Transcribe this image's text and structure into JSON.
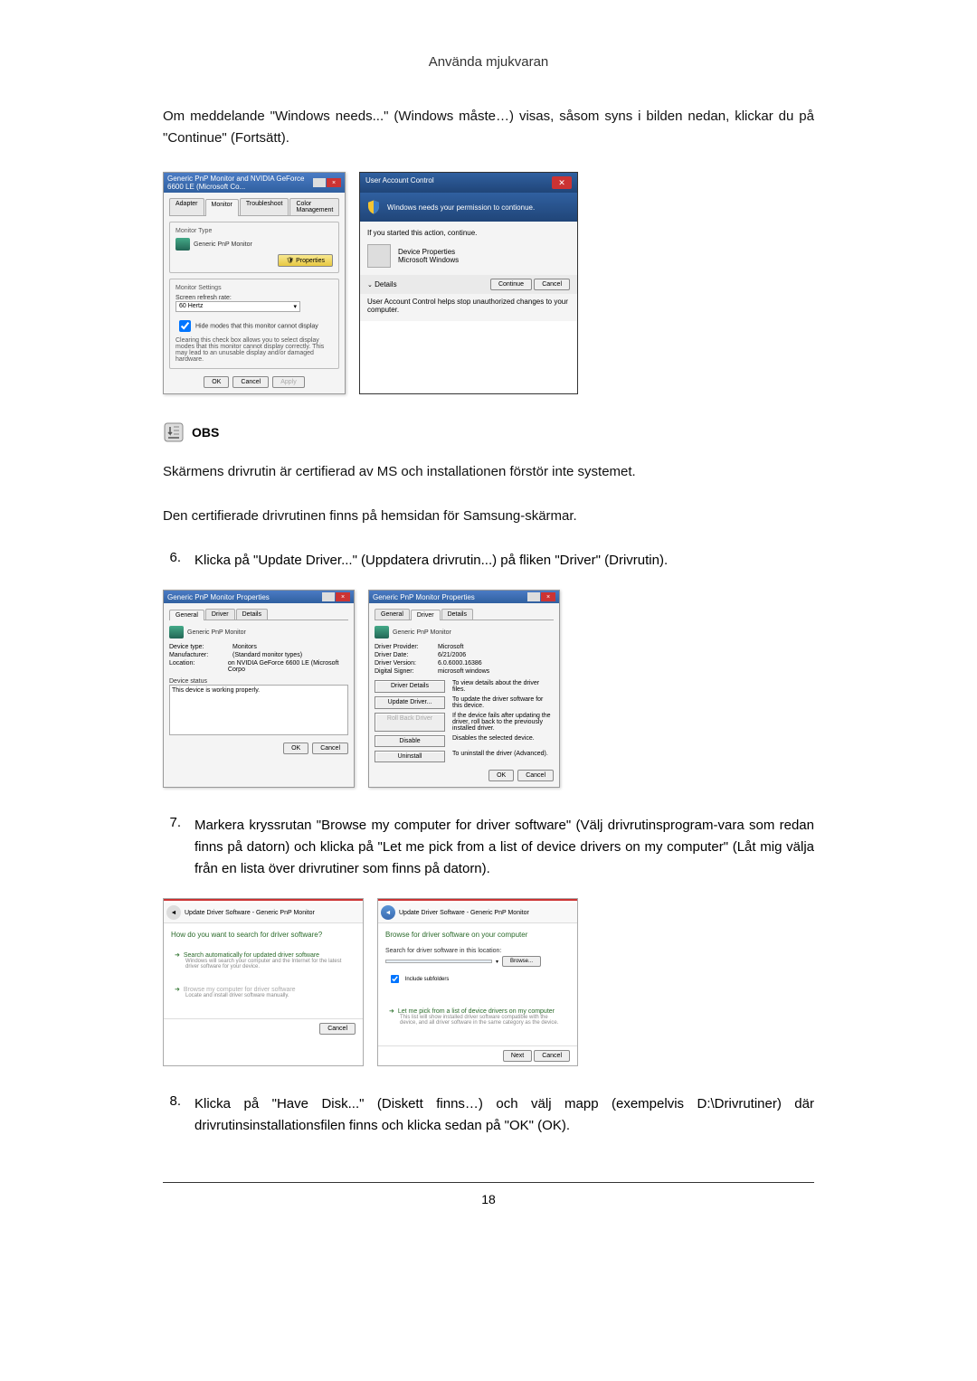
{
  "page": {
    "header_title": "Använda mjukvaran",
    "intro_text": "Om meddelande \"Windows needs...\" (Windows måste…) visas, såsom syns i bilden nedan, klickar du på \"Continue\" (Fortsätt).",
    "page_number": "18"
  },
  "dialog1": {
    "title": "Generic PnP Monitor and NVIDIA GeForce 6600 LE (Microsoft Co...",
    "tabs": {
      "adapter": "Adapter",
      "monitor": "Monitor",
      "troubleshoot": "Troubleshoot",
      "color": "Color Management"
    },
    "monitor_type_label": "Monitor Type",
    "monitor_name": "Generic PnP Monitor",
    "properties_btn": "Properties",
    "settings_label": "Monitor Settings",
    "refresh_label": "Screen refresh rate:",
    "refresh_value": "60 Hertz",
    "checkbox_label": "Hide modes that this monitor cannot display",
    "warning_text": "Clearing this check box allows you to select display modes that this monitor cannot display correctly. This may lead to an unusable display and/or damaged hardware.",
    "ok": "OK",
    "cancel": "Cancel",
    "apply": "Apply"
  },
  "uac": {
    "title": "User Account Control",
    "heading": "Windows needs your permission to contionue.",
    "subtext": "If you started this action, continue.",
    "device_props": "Device Properties",
    "ms_windows": "Microsoft Windows",
    "details": "Details",
    "continue_btn": "Continue",
    "cancel_btn": "Cancel",
    "footer": "User Account Control helps stop unauthorized changes to your computer."
  },
  "note": {
    "label": "OBS",
    "text1": "Skärmens drivrutin är certifierad av MS och installationen förstör inte systemet.",
    "text2": "Den certifierade drivrutinen finns på hemsidan för Samsung-skärmar."
  },
  "step6": {
    "num": "6.",
    "text": "Klicka på \"Update Driver...\" (Uppdatera drivrutin...) på fliken \"Driver\" (Drivrutin)."
  },
  "props_general": {
    "title": "Generic PnP Monitor Properties",
    "tabs": {
      "general": "General",
      "driver": "Driver",
      "details": "Details"
    },
    "name": "Generic PnP Monitor",
    "device_type_lbl": "Device type:",
    "device_type_val": "Monitors",
    "manufacturer_lbl": "Manufacturer:",
    "manufacturer_val": "(Standard monitor types)",
    "location_lbl": "Location:",
    "location_val": "on NVIDIA GeForce 6600 LE (Microsoft Corpo",
    "status_label": "Device status",
    "status_text": "This device is working properly.",
    "ok": "OK",
    "cancel": "Cancel"
  },
  "props_driver": {
    "title": "Generic PnP Monitor Properties",
    "name": "Generic PnP Monitor",
    "provider_lbl": "Driver Provider:",
    "provider_val": "Microsoft",
    "date_lbl": "Driver Date:",
    "date_val": "6/21/2006",
    "version_lbl": "Driver Version:",
    "version_val": "6.0.6000.16386",
    "signer_lbl": "Digital Signer:",
    "signer_val": "microsoft windows",
    "driver_details_btn": "Driver Details",
    "driver_details_desc": "To view details about the driver files.",
    "update_btn": "Update Driver...",
    "update_desc": "To update the driver software for this device.",
    "rollback_btn": "Roll Back Driver",
    "rollback_desc": "If the device fails after updating the driver, roll back to the previously installed driver.",
    "disable_btn": "Disable",
    "disable_desc": "Disables the selected device.",
    "uninstall_btn": "Uninstall",
    "uninstall_desc": "To uninstall the driver (Advanced).",
    "ok": "OK",
    "cancel": "Cancel"
  },
  "step7": {
    "num": "7.",
    "text": "Markera kryssrutan \"Browse my computer for driver software\" (Välj drivrutinsprogram-vara som redan finns på datorn) och klicka på \"Let me pick from a list of device drivers on my computer\" (Låt mig välja från en lista över drivrutiner som finns på datorn)."
  },
  "wizard1": {
    "breadcrumb": "Update Driver Software - Generic PnP Monitor",
    "heading": "How do you want to search for driver software?",
    "opt1_title": "Search automatically for updated driver software",
    "opt1_sub": "Windows will search your computer and the Internet for the latest driver software for your device.",
    "opt2_title": "Browse my computer for driver software",
    "opt2_sub": "Locate and install driver software manually.",
    "cancel": "Cancel"
  },
  "wizard2": {
    "breadcrumb": "Update Driver Software - Generic PnP Monitor",
    "heading": "Browse for driver software on your computer",
    "search_label": "Search for driver software in this location:",
    "browse_btn": "Browse...",
    "include_sub": "Include subfolders",
    "pick_title": "Let me pick from a list of device drivers on my computer",
    "pick_sub": "This list will show installed driver software compatible with the device, and all driver software in the same category as the device.",
    "next": "Next",
    "cancel": "Cancel"
  },
  "step8": {
    "num": "8.",
    "text": "Klicka på \"Have Disk...\" (Diskett finns…) och välj mapp (exempelvis D:\\Drivrutiner) där drivrutinsinstallationsfilen finns och klicka sedan på \"OK\" (OK)."
  }
}
